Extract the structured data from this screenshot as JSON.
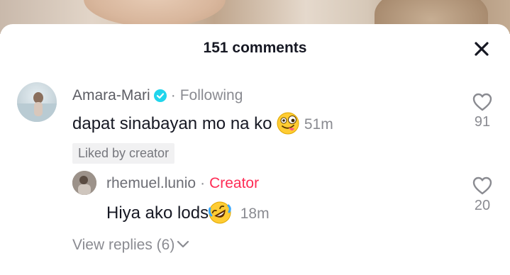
{
  "header": {
    "comment_count_label": "151 comments"
  },
  "comment": {
    "username": "Amara-Mari",
    "separator": "·",
    "following_label": "Following",
    "text": "dapat sinabayan mo na ko",
    "emoji": "zany-face-emoji",
    "time": "51m",
    "liked_by_creator_label": "Liked by creator",
    "like_count": "91"
  },
  "reply": {
    "username": "rhemuel.lunio",
    "separator": "·",
    "creator_label": "Creator",
    "text": "Hiya ako lods",
    "emoji": "rolling-on-floor-laughing-emoji",
    "time": "18m",
    "like_count": "20"
  },
  "view_replies_label": "View replies (6)",
  "colors": {
    "text_primary": "#161823",
    "text_secondary": "#8a8b91",
    "verified_blue": "#20d5ec",
    "creator_red": "#fe2c55",
    "badge_bg": "#f1f1f2"
  }
}
